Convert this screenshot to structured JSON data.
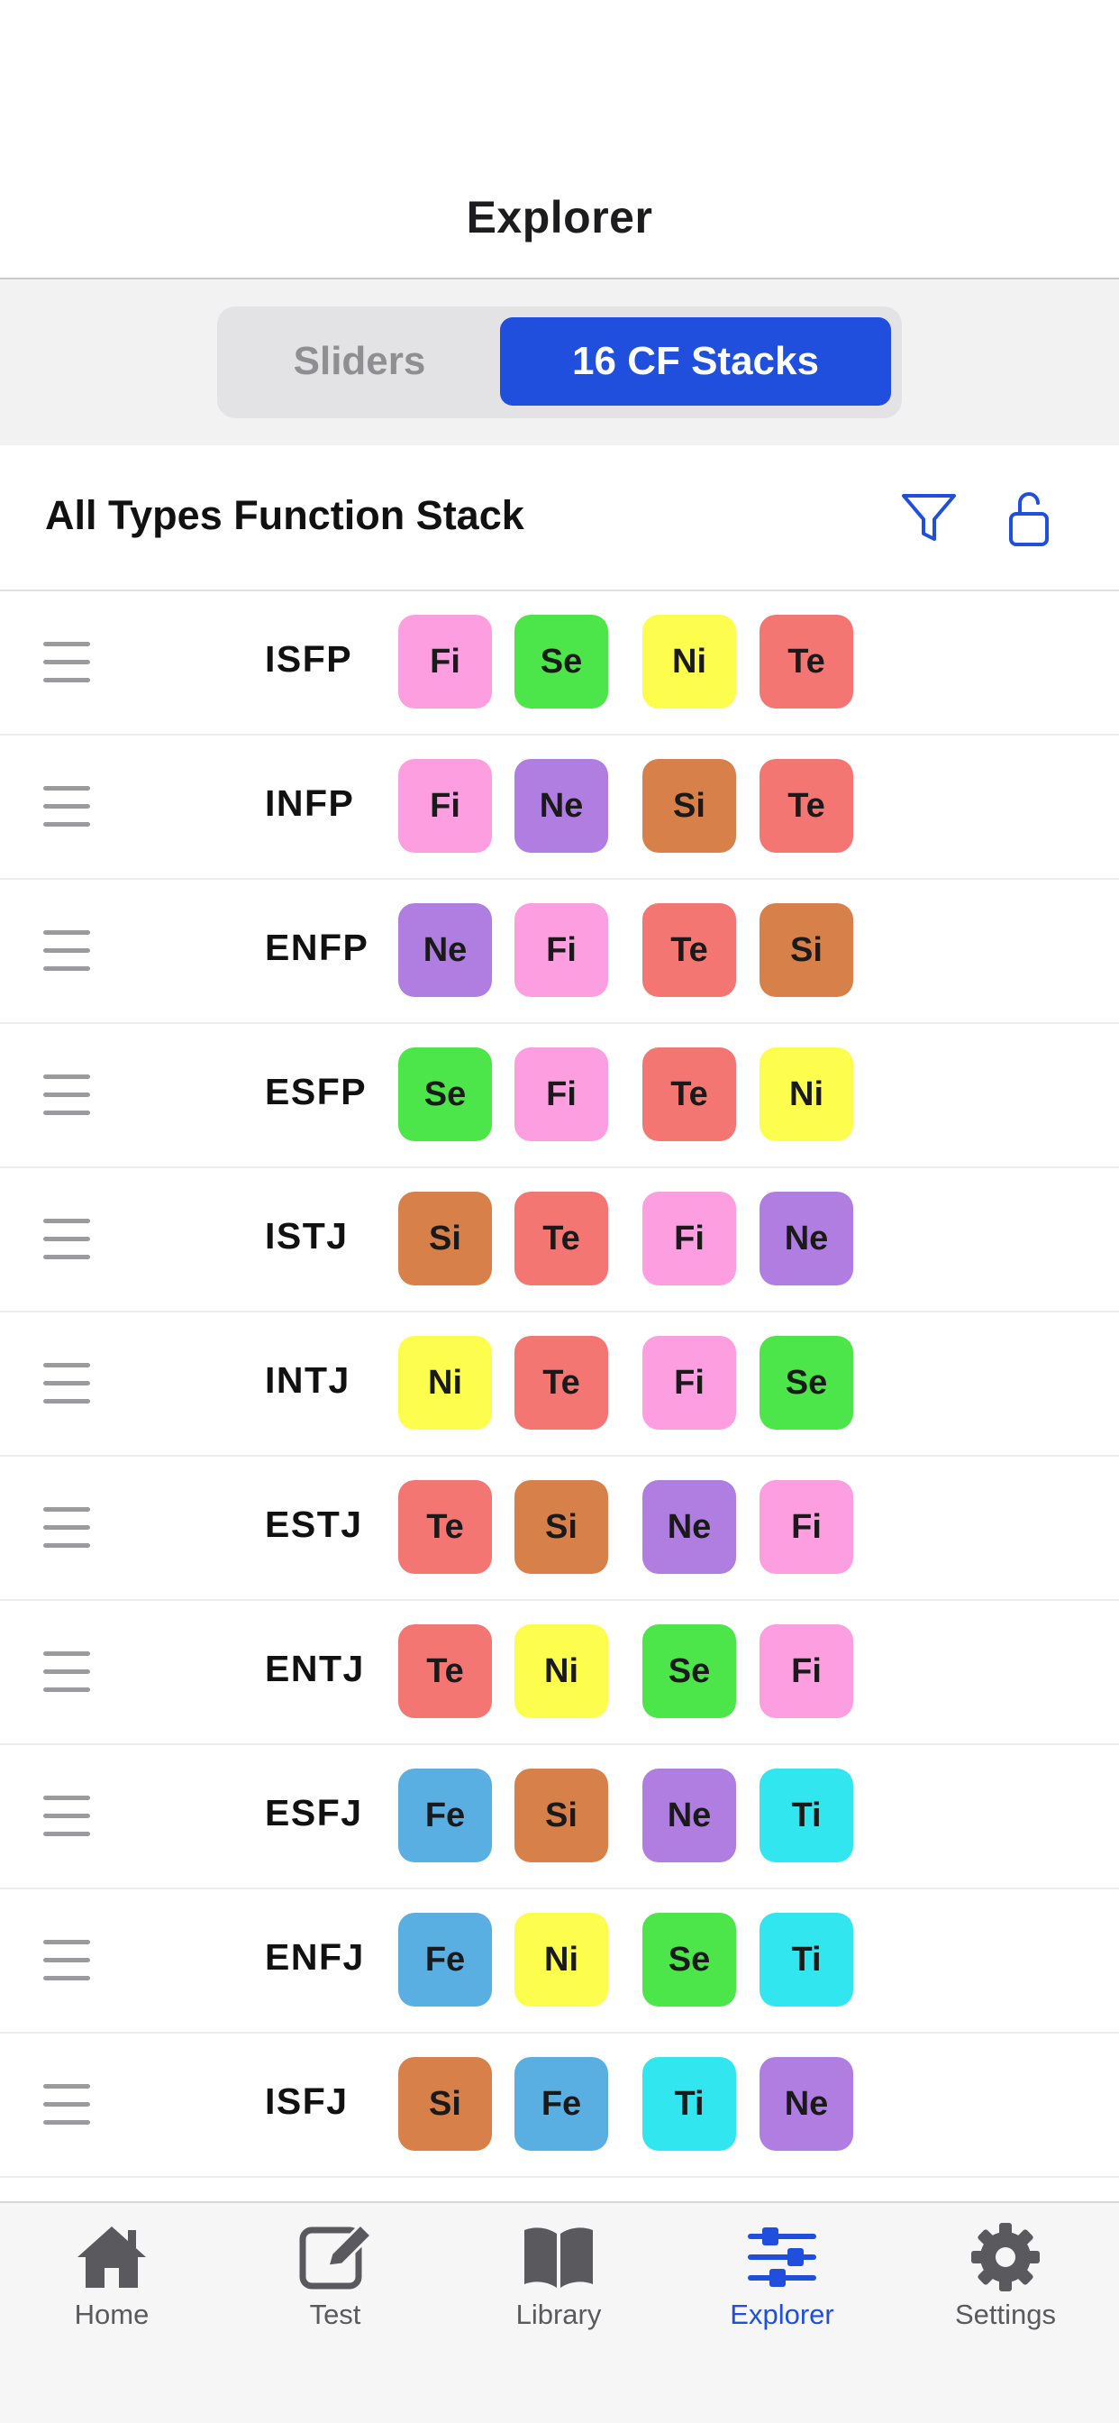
{
  "header": {
    "title": "Explorer"
  },
  "segments": {
    "sliders": "Sliders",
    "stacks": "16 CF Stacks",
    "selected": "16 CF Stacks"
  },
  "section": {
    "title": "All Types Function Stack",
    "filter_icon": "filter-icon",
    "lock_icon": "unlock-icon"
  },
  "colors": {
    "Fi": "#fd9ee1",
    "Fe": "#5aafe2",
    "Se": "#4ce54a",
    "Si": "#d8804a",
    "Ne": "#b07ee0",
    "Ni": "#fdfd4e",
    "Te": "#f47673",
    "Ti": "#32e6f0",
    "accent": "#1f4fdc"
  },
  "rows": [
    {
      "type": "ISFP",
      "stack": [
        "Fi",
        "Se",
        "Ni",
        "Te"
      ]
    },
    {
      "type": "INFP",
      "stack": [
        "Fi",
        "Ne",
        "Si",
        "Te"
      ]
    },
    {
      "type": "ENFP",
      "stack": [
        "Ne",
        "Fi",
        "Te",
        "Si"
      ]
    },
    {
      "type": "ESFP",
      "stack": [
        "Se",
        "Fi",
        "Te",
        "Ni"
      ]
    },
    {
      "type": "ISTJ",
      "stack": [
        "Si",
        "Te",
        "Fi",
        "Ne"
      ]
    },
    {
      "type": "INTJ",
      "stack": [
        "Ni",
        "Te",
        "Fi",
        "Se"
      ]
    },
    {
      "type": "ESTJ",
      "stack": [
        "Te",
        "Si",
        "Ne",
        "Fi"
      ]
    },
    {
      "type": "ENTJ",
      "stack": [
        "Te",
        "Ni",
        "Se",
        "Fi"
      ]
    },
    {
      "type": "ESFJ",
      "stack": [
        "Fe",
        "Si",
        "Ne",
        "Ti"
      ]
    },
    {
      "type": "ENFJ",
      "stack": [
        "Fe",
        "Ni",
        "Se",
        "Ti"
      ]
    },
    {
      "type": "ISFJ",
      "stack": [
        "Si",
        "Fe",
        "Ti",
        "Ne"
      ]
    }
  ],
  "tabbar": {
    "items": [
      {
        "label": "Home",
        "icon": "home-icon"
      },
      {
        "label": "Test",
        "icon": "edit-icon"
      },
      {
        "label": "Library",
        "icon": "book-icon"
      },
      {
        "label": "Explorer",
        "icon": "sliders-icon"
      },
      {
        "label": "Settings",
        "icon": "gear-icon"
      }
    ],
    "active": "Explorer"
  }
}
